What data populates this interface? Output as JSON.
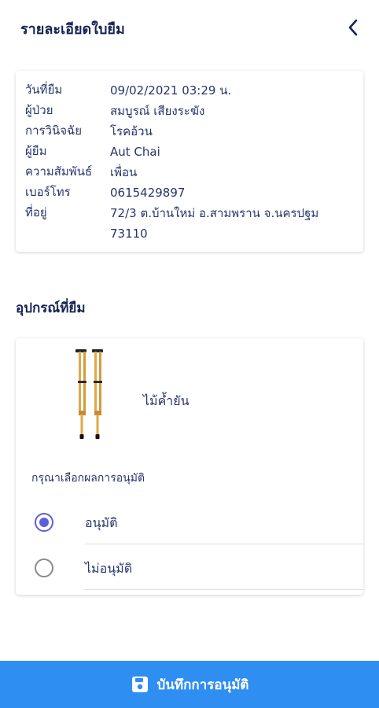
{
  "header": {
    "title": "รายละเอียดใบยืม",
    "back_icon": "chevron-left-icon"
  },
  "info": {
    "rows": [
      {
        "label": "วันที่ยืม",
        "value": "09/02/2021 03:29 น."
      },
      {
        "label": "ผู้ป่วย",
        "value": "สมบูรณ์ เสียงระฆัง"
      },
      {
        "label": "การวินิจฉัย",
        "value": "โรคอ้วน"
      },
      {
        "label": "ผู้ยืม",
        "value": "Aut Chai"
      },
      {
        "label": "ความสัมพันธ์",
        "value": "เพื่อน"
      },
      {
        "label": "เบอร์โทร",
        "value": "0615429897"
      },
      {
        "label": "ที่อยู่",
        "value": "72/3 ต.บ้านใหม่ อ.สามพราน จ.นครปฐม 73110"
      }
    ]
  },
  "equipment": {
    "section_title": "อุปกรณ์ที่ยืม",
    "item_name": "ไม้ค้ำยัน",
    "item_icon": "crutches-image",
    "prompt": "กรุณาเลือกผลการอนุมัติ",
    "options": [
      {
        "label": "อนุมัติ",
        "selected": true
      },
      {
        "label": "ไม่อนุมัติ",
        "selected": false
      }
    ]
  },
  "footer": {
    "save_label": "บันทึกการอนุมัติ",
    "icon": "save-icon"
  },
  "colors": {
    "accent": "#2f8ef2",
    "radio": "#5b5fd9",
    "title": "#152454"
  }
}
